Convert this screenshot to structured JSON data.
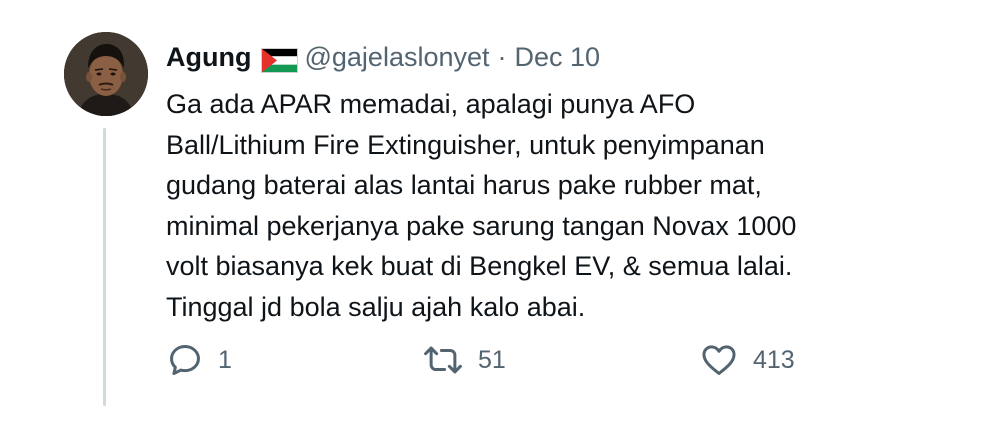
{
  "tweet": {
    "author_name": "Agung",
    "flag_icon": "palestine-flag-icon",
    "handle": "@gajelaslonyet",
    "separator": "·",
    "date": "Dec 10",
    "text_lines": [
      "Ga ada APAR memadai, apalagi punya AFO",
      "Ball/Lithium Fire Extinguisher, untuk penyimpanan",
      "gudang baterai alas lantai harus pake rubber mat,",
      "minimal pekerjanya pake sarung tangan Novax 1000",
      "volt biasanya kek buat di Bengkel EV, & semua lalai.",
      "Tinggal jd bola salju ajah kalo abai."
    ],
    "actions": {
      "reply_icon": "reply-icon",
      "reply_count": "1",
      "retweet_icon": "retweet-icon",
      "retweet_count": "51",
      "like_icon": "heart-icon",
      "like_count": "413"
    }
  },
  "colors": {
    "text_primary": "#0f1419",
    "text_secondary": "#536471",
    "thread_line": "#cfd9de",
    "background": "#ffffff"
  }
}
